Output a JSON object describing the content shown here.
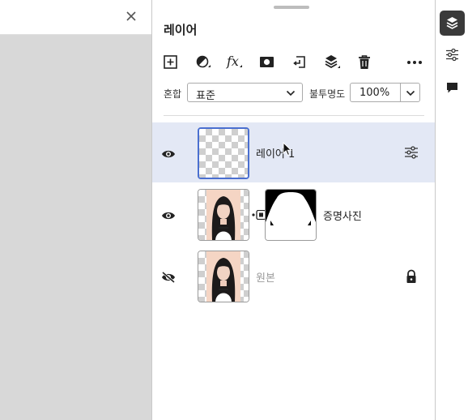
{
  "panel": {
    "title": "레이어"
  },
  "toolbar": {
    "add_icon": "plus-square-icon",
    "adjust_icon": "half-circle-icon",
    "fx_label": "fx",
    "mask_icon": "mask-icon",
    "clip_icon": "clip-icon",
    "stack_icon": "layers-stack-icon",
    "delete_icon": "trash-icon",
    "more_icon": "more-icon"
  },
  "blend": {
    "label": "혼합",
    "value": "표준"
  },
  "opacity": {
    "label": "불투명도",
    "value": "100%"
  },
  "layers": [
    {
      "name": "레이어 1",
      "visible": true,
      "selected": true
    },
    {
      "name": "증명사진",
      "visible": true,
      "selected": false
    },
    {
      "name": "원본",
      "visible": false,
      "selected": false,
      "locked": true
    }
  ],
  "colors": {
    "selected_row": "#e3e8f5",
    "active_border": "#4a6fd0",
    "muted_text": "#9a9a9a"
  }
}
